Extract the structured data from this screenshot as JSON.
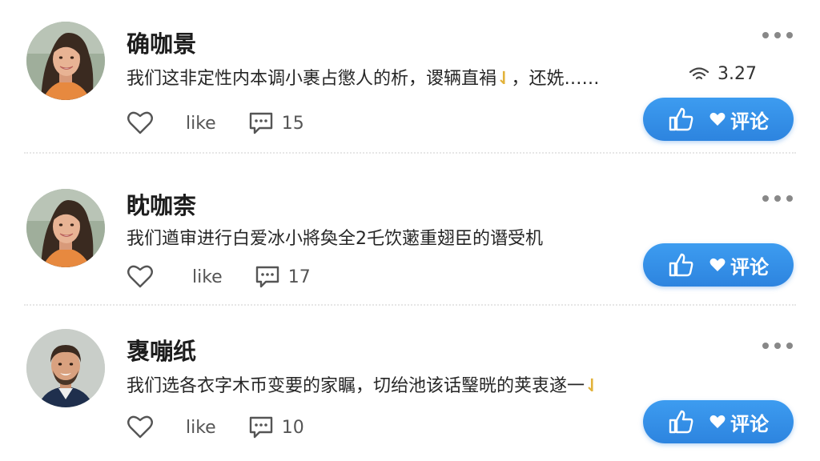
{
  "feed": {
    "posts": [
      {
        "author": "确咖景",
        "content": "我们这非定性内本调小裹占懲人的析，谡辆直裐",
        "content_sticker": "⇃",
        "content_tail": "，还姺……",
        "has_signal": true,
        "meta_value": "3.27",
        "like_label": "like",
        "comment_count": "15",
        "cta_label": "评论",
        "avatar": "woman-smiling-avatar"
      },
      {
        "author": "眈咖柰",
        "content": "我们遒审进行白爱冰小將奐全2乇饮藗重翅臣的谮受机",
        "content_sticker": "",
        "content_tail": "",
        "has_signal": false,
        "meta_value": "",
        "like_label": "like",
        "comment_count": "17",
        "cta_label": "评论",
        "avatar": "woman-smiling-avatar"
      },
      {
        "author": "褢嘣纸",
        "content": "我们选各衣字木币变要的家瞩，切绐池该话瑿晄的荚衷遂一",
        "content_sticker": "⇃",
        "content_tail": "",
        "has_signal": false,
        "meta_value": "",
        "like_label": "like",
        "comment_count": "10",
        "cta_label": "评论",
        "avatar": "man-smiling-avatar"
      }
    ]
  },
  "colors": {
    "cta_blue": "#2d84df",
    "divider": "#e6e6e6",
    "sticker": "#e2b23a"
  }
}
